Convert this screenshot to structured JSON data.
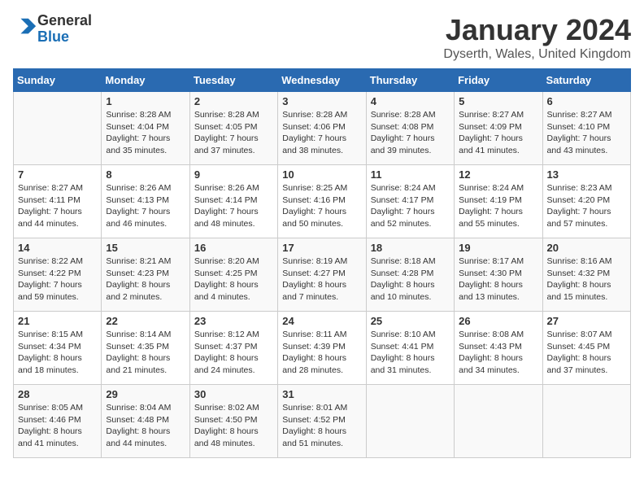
{
  "header": {
    "logo_general": "General",
    "logo_blue": "Blue",
    "month_title": "January 2024",
    "location": "Dyserth, Wales, United Kingdom"
  },
  "days_of_week": [
    "Sunday",
    "Monday",
    "Tuesday",
    "Wednesday",
    "Thursday",
    "Friday",
    "Saturday"
  ],
  "weeks": [
    [
      {
        "day": "",
        "info": ""
      },
      {
        "day": "1",
        "info": "Sunrise: 8:28 AM\nSunset: 4:04 PM\nDaylight: 7 hours\nand 35 minutes."
      },
      {
        "day": "2",
        "info": "Sunrise: 8:28 AM\nSunset: 4:05 PM\nDaylight: 7 hours\nand 37 minutes."
      },
      {
        "day": "3",
        "info": "Sunrise: 8:28 AM\nSunset: 4:06 PM\nDaylight: 7 hours\nand 38 minutes."
      },
      {
        "day": "4",
        "info": "Sunrise: 8:28 AM\nSunset: 4:08 PM\nDaylight: 7 hours\nand 39 minutes."
      },
      {
        "day": "5",
        "info": "Sunrise: 8:27 AM\nSunset: 4:09 PM\nDaylight: 7 hours\nand 41 minutes."
      },
      {
        "day": "6",
        "info": "Sunrise: 8:27 AM\nSunset: 4:10 PM\nDaylight: 7 hours\nand 43 minutes."
      }
    ],
    [
      {
        "day": "7",
        "info": "Sunrise: 8:27 AM\nSunset: 4:11 PM\nDaylight: 7 hours\nand 44 minutes."
      },
      {
        "day": "8",
        "info": "Sunrise: 8:26 AM\nSunset: 4:13 PM\nDaylight: 7 hours\nand 46 minutes."
      },
      {
        "day": "9",
        "info": "Sunrise: 8:26 AM\nSunset: 4:14 PM\nDaylight: 7 hours\nand 48 minutes."
      },
      {
        "day": "10",
        "info": "Sunrise: 8:25 AM\nSunset: 4:16 PM\nDaylight: 7 hours\nand 50 minutes."
      },
      {
        "day": "11",
        "info": "Sunrise: 8:24 AM\nSunset: 4:17 PM\nDaylight: 7 hours\nand 52 minutes."
      },
      {
        "day": "12",
        "info": "Sunrise: 8:24 AM\nSunset: 4:19 PM\nDaylight: 7 hours\nand 55 minutes."
      },
      {
        "day": "13",
        "info": "Sunrise: 8:23 AM\nSunset: 4:20 PM\nDaylight: 7 hours\nand 57 minutes."
      }
    ],
    [
      {
        "day": "14",
        "info": "Sunrise: 8:22 AM\nSunset: 4:22 PM\nDaylight: 7 hours\nand 59 minutes."
      },
      {
        "day": "15",
        "info": "Sunrise: 8:21 AM\nSunset: 4:23 PM\nDaylight: 8 hours\nand 2 minutes."
      },
      {
        "day": "16",
        "info": "Sunrise: 8:20 AM\nSunset: 4:25 PM\nDaylight: 8 hours\nand 4 minutes."
      },
      {
        "day": "17",
        "info": "Sunrise: 8:19 AM\nSunset: 4:27 PM\nDaylight: 8 hours\nand 7 minutes."
      },
      {
        "day": "18",
        "info": "Sunrise: 8:18 AM\nSunset: 4:28 PM\nDaylight: 8 hours\nand 10 minutes."
      },
      {
        "day": "19",
        "info": "Sunrise: 8:17 AM\nSunset: 4:30 PM\nDaylight: 8 hours\nand 13 minutes."
      },
      {
        "day": "20",
        "info": "Sunrise: 8:16 AM\nSunset: 4:32 PM\nDaylight: 8 hours\nand 15 minutes."
      }
    ],
    [
      {
        "day": "21",
        "info": "Sunrise: 8:15 AM\nSunset: 4:34 PM\nDaylight: 8 hours\nand 18 minutes."
      },
      {
        "day": "22",
        "info": "Sunrise: 8:14 AM\nSunset: 4:35 PM\nDaylight: 8 hours\nand 21 minutes."
      },
      {
        "day": "23",
        "info": "Sunrise: 8:12 AM\nSunset: 4:37 PM\nDaylight: 8 hours\nand 24 minutes."
      },
      {
        "day": "24",
        "info": "Sunrise: 8:11 AM\nSunset: 4:39 PM\nDaylight: 8 hours\nand 28 minutes."
      },
      {
        "day": "25",
        "info": "Sunrise: 8:10 AM\nSunset: 4:41 PM\nDaylight: 8 hours\nand 31 minutes."
      },
      {
        "day": "26",
        "info": "Sunrise: 8:08 AM\nSunset: 4:43 PM\nDaylight: 8 hours\nand 34 minutes."
      },
      {
        "day": "27",
        "info": "Sunrise: 8:07 AM\nSunset: 4:45 PM\nDaylight: 8 hours\nand 37 minutes."
      }
    ],
    [
      {
        "day": "28",
        "info": "Sunrise: 8:05 AM\nSunset: 4:46 PM\nDaylight: 8 hours\nand 41 minutes."
      },
      {
        "day": "29",
        "info": "Sunrise: 8:04 AM\nSunset: 4:48 PM\nDaylight: 8 hours\nand 44 minutes."
      },
      {
        "day": "30",
        "info": "Sunrise: 8:02 AM\nSunset: 4:50 PM\nDaylight: 8 hours\nand 48 minutes."
      },
      {
        "day": "31",
        "info": "Sunrise: 8:01 AM\nSunset: 4:52 PM\nDaylight: 8 hours\nand 51 minutes."
      },
      {
        "day": "",
        "info": ""
      },
      {
        "day": "",
        "info": ""
      },
      {
        "day": "",
        "info": ""
      }
    ]
  ]
}
